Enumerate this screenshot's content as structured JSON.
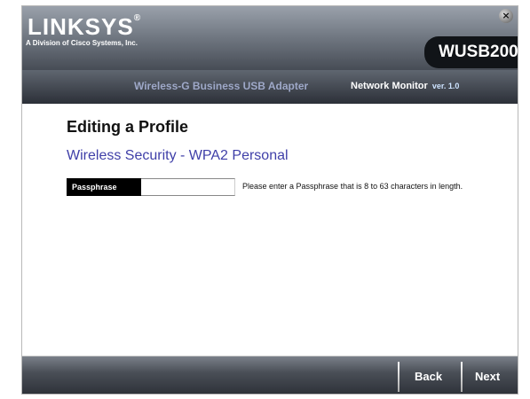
{
  "header": {
    "logo_text": "LINKSYS",
    "logo_trademark": "®",
    "logo_subtitle": "A Division of Cisco Systems, Inc.",
    "close_icon": "×",
    "model": "WUSB200",
    "product_name": "Wireless-G Business USB Adapter",
    "monitor_label": "Network Monitor",
    "version": "ver. 1.0"
  },
  "main": {
    "title": "Editing a Profile",
    "section_title": "Wireless Security - WPA2 Personal",
    "passphrase": {
      "label": "Passphrase",
      "value": "",
      "hint": "Please enter a Passphrase that is 8 to 63 characters in length."
    }
  },
  "footer": {
    "back_label": "Back",
    "next_label": "Next"
  },
  "colors": {
    "section_title": "#3f3fa8",
    "header_dark": "#2a2e35",
    "model_tab": "#111418"
  }
}
